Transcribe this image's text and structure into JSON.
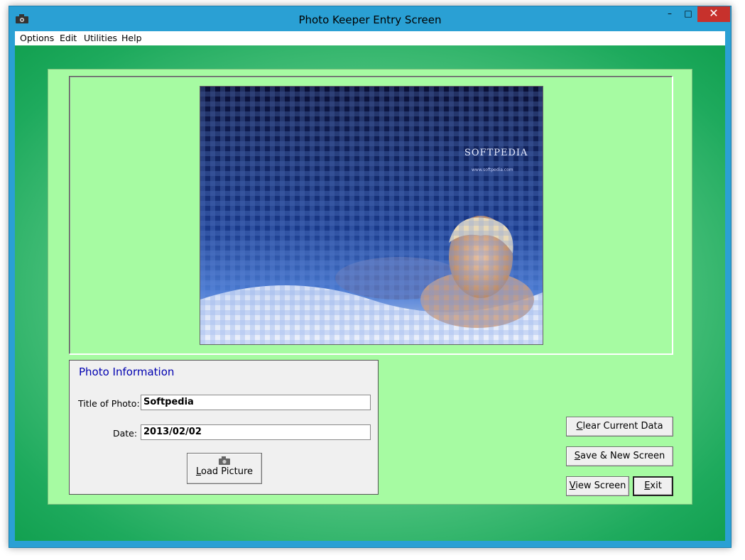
{
  "window": {
    "title": "Photo Keeper Entry Screen",
    "app_icon": "camera-icon",
    "controls": {
      "minimize": "–",
      "maximize": "□",
      "close": "✕"
    }
  },
  "menu": {
    "items": [
      "Options",
      "Edit",
      "Utilities",
      "Help"
    ]
  },
  "photo": {
    "brand_text": "SOFTPEDIA",
    "brand_url": "www.softpedia.com"
  },
  "info": {
    "heading": "Photo Information",
    "title_label": "Title of Photo:",
    "title_value": "Softpedia",
    "date_label": "Date:",
    "date_value": "2013/02/02",
    "load_button": {
      "mnemonic": "L",
      "rest": "oad Picture",
      "icon": "camera-icon"
    }
  },
  "buttons": {
    "clear": {
      "mnemonic": "C",
      "rest": "lear Current Data"
    },
    "save": {
      "mnemonic": "S",
      "rest": "ave & New Screen"
    },
    "view": {
      "mnemonic": "V",
      "rest": "iew Screen"
    },
    "exit": {
      "mnemonic": "E",
      "rest": "xit"
    }
  },
  "colors": {
    "panel_bg": "#a6fba2",
    "client_gradient_edge": "#12a050",
    "info_heading": "#0000b0",
    "close_button": "#c7312c",
    "title_bar": "#2aa0d4"
  }
}
